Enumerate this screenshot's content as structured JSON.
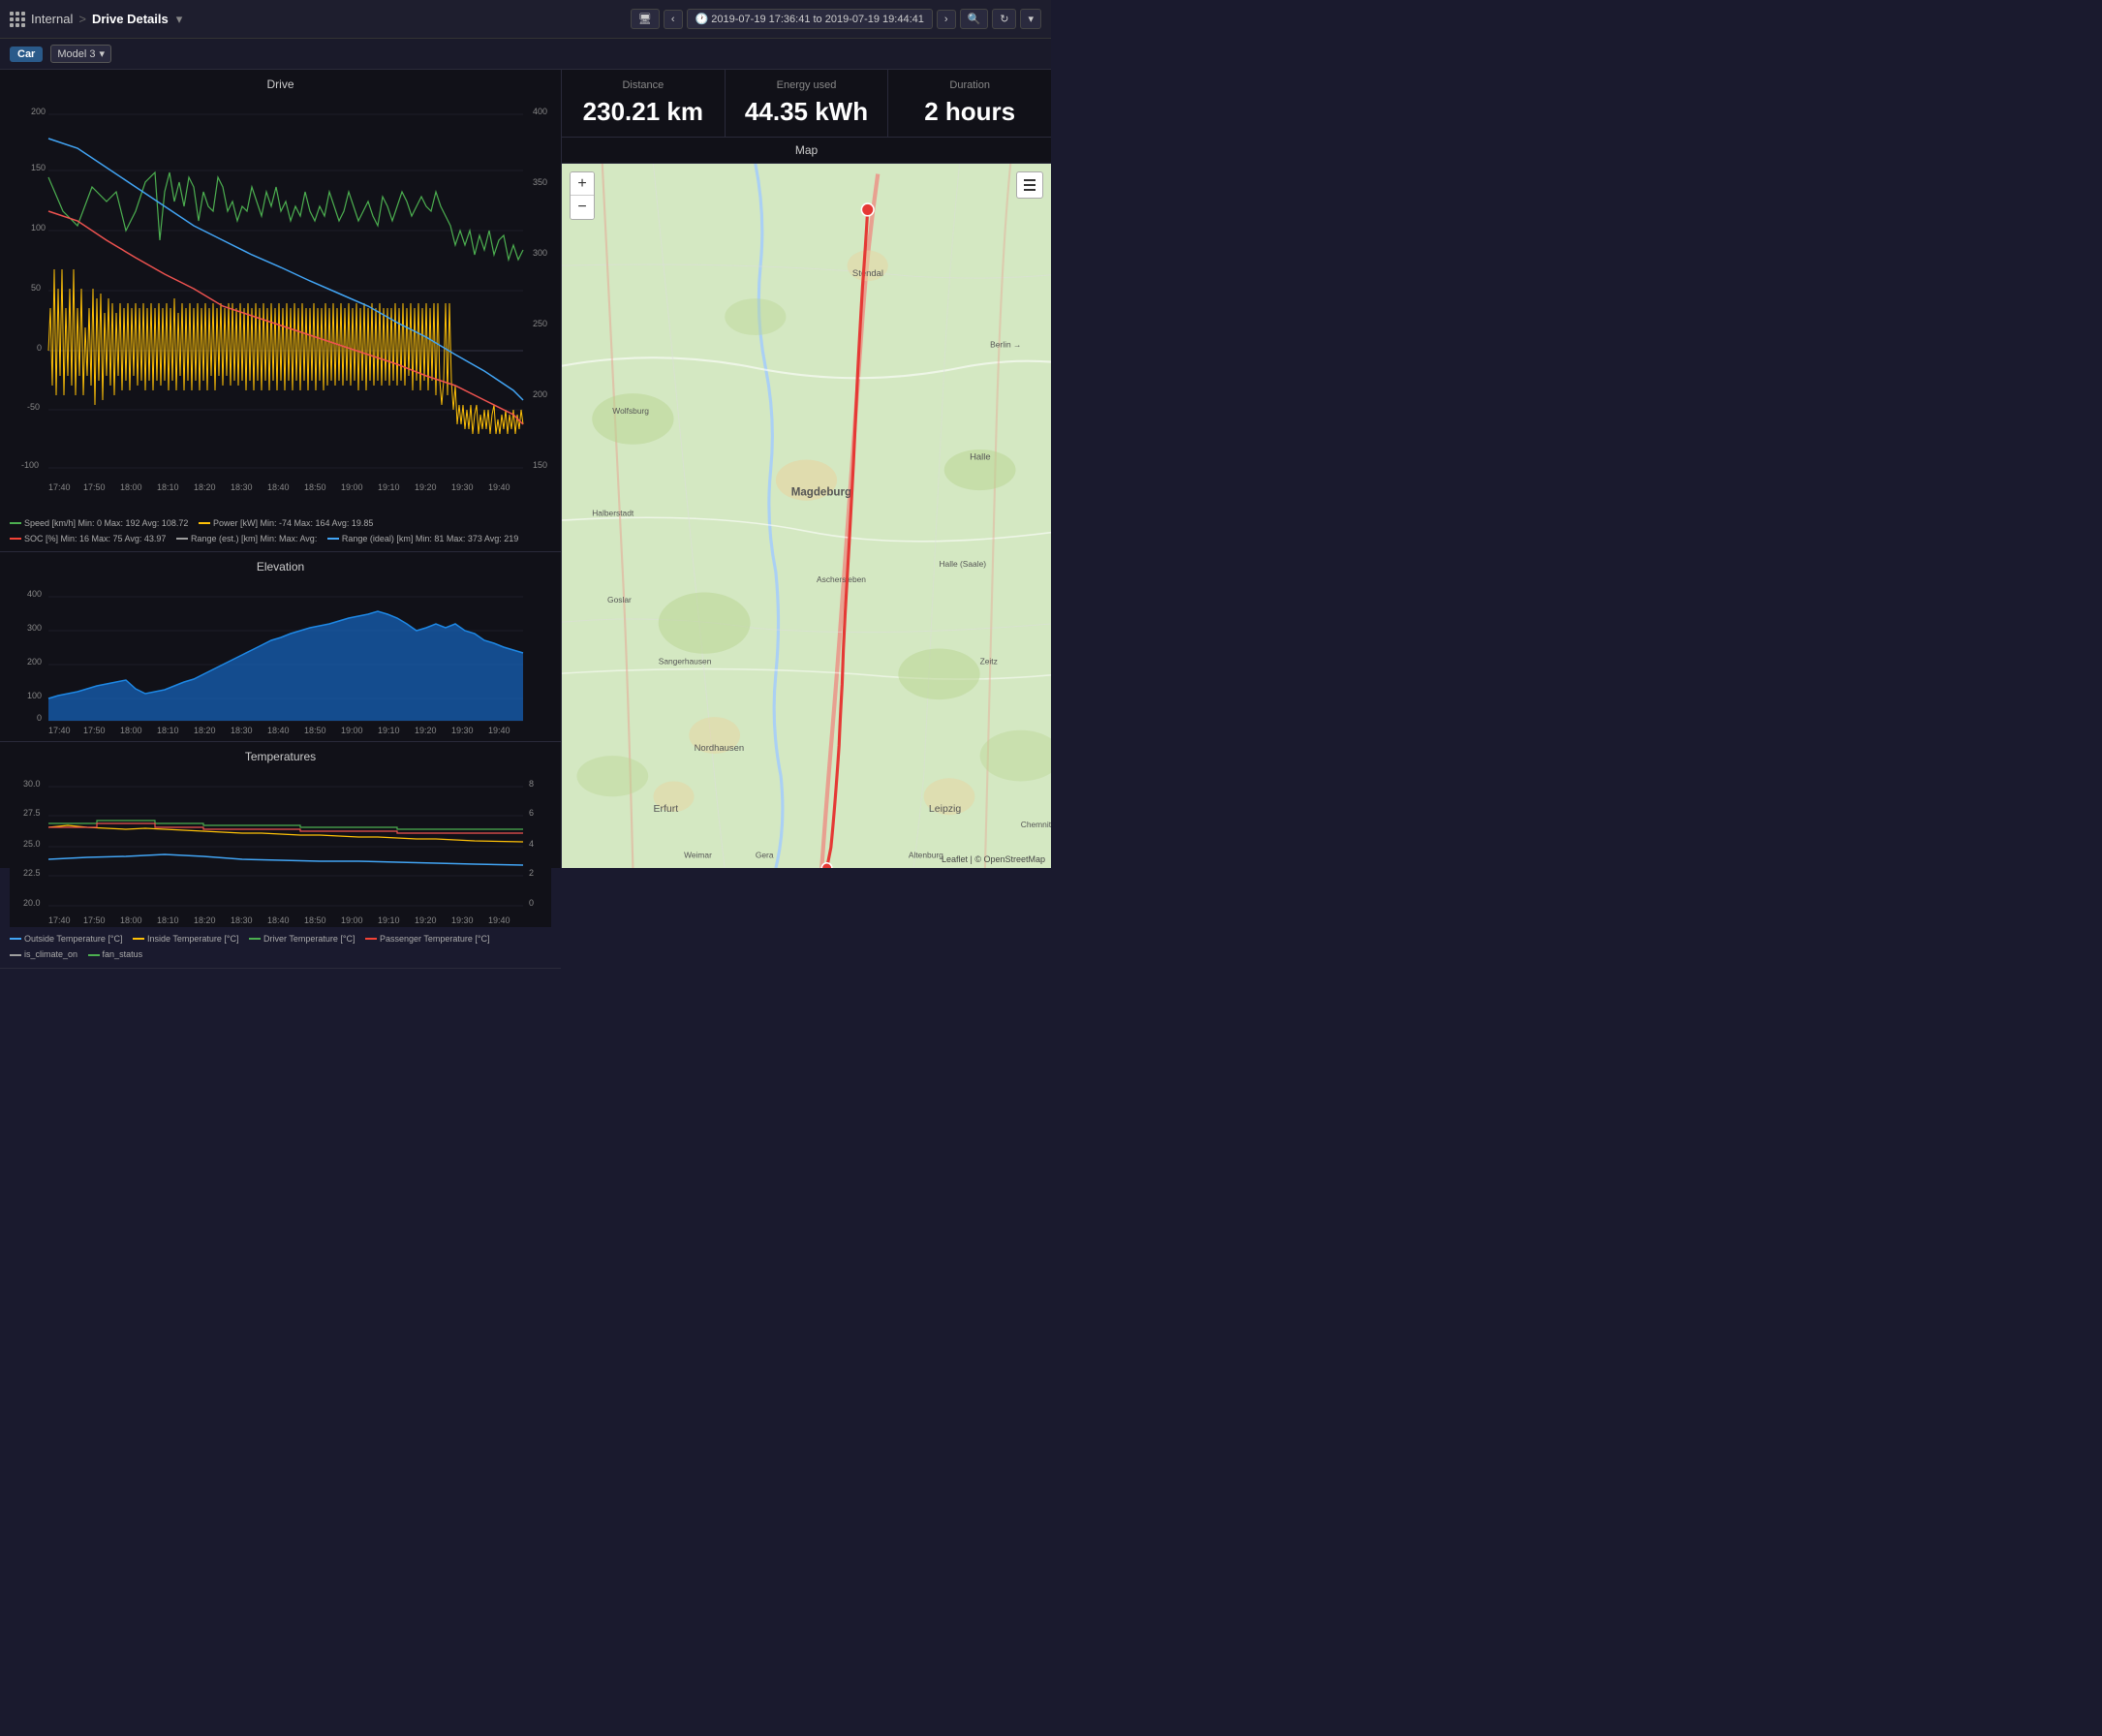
{
  "header": {
    "app_name": "Internal",
    "separator": ">",
    "page_title": "Drive Details",
    "dropdown_arrow": "▾",
    "time_range": "🕐 2019-07-19 17:36:41 to 2019-07-19 19:44:41",
    "nav_left": "‹",
    "nav_right": "›",
    "search_icon": "🔍",
    "refresh_icon": "↻",
    "more_icon": "▾",
    "monitor_icon": "🖥"
  },
  "sub_header": {
    "car_tag": "Car",
    "model_label": "Model 3",
    "dropdown_arrow": "▾"
  },
  "stats": {
    "distance_label": "Distance",
    "distance_value": "230.21 km",
    "energy_label": "Energy used",
    "energy_value": "44.35 kWh",
    "duration_label": "Duration",
    "duration_value": "2 hours"
  },
  "charts": {
    "drive_title": "Drive",
    "elevation_title": "Elevation",
    "temperatures_title": "Temperatures"
  },
  "map": {
    "title": "Map",
    "zoom_in": "+",
    "zoom_out": "−",
    "credit": "Leaflet | © OpenStreetMap"
  },
  "drive_legend": [
    {
      "label": "Speed [km/h]  Min: 0  Max: 192  Avg: 108.72",
      "color": "#4caf50",
      "style": "solid"
    },
    {
      "label": "Power [kW]  Min: -74  Max: 164  Avg: 19.85",
      "color": "#ffc107",
      "style": "solid"
    },
    {
      "label": "SOC [%]  Min: 16  Max: 75  Avg: 43.97",
      "color": "#f44336",
      "style": "solid"
    },
    {
      "label": "Range (est.) [km]  Min:   Max:   Avg:",
      "color": "#9e9e9e",
      "style": "dashed"
    },
    {
      "label": "Range (ideal) [km]  Min: 81  Max: 373  Avg: 219",
      "color": "#42a5f5",
      "style": "solid"
    }
  ],
  "temp_legend": [
    {
      "label": "Outside Temperature [°C]",
      "color": "#42a5f5",
      "style": "solid"
    },
    {
      "label": "Inside Temperature [°C]",
      "color": "#ffc107",
      "style": "solid"
    },
    {
      "label": "Driver Temperature [°C]",
      "color": "#4caf50",
      "style": "solid"
    },
    {
      "label": "Passenger Temperature [°C]",
      "color": "#f44336",
      "style": "solid"
    },
    {
      "label": "is_climate_on",
      "color": "#9e9e9e",
      "style": "dashed"
    },
    {
      "label": "fan_status",
      "color": "#4caf50",
      "style": "dashed"
    }
  ],
  "time_labels": [
    "17:40",
    "17:50",
    "18:00",
    "18:10",
    "18:20",
    "18:30",
    "18:40",
    "18:50",
    "19:00",
    "19:10",
    "19:20",
    "19:30",
    "19:40"
  ]
}
